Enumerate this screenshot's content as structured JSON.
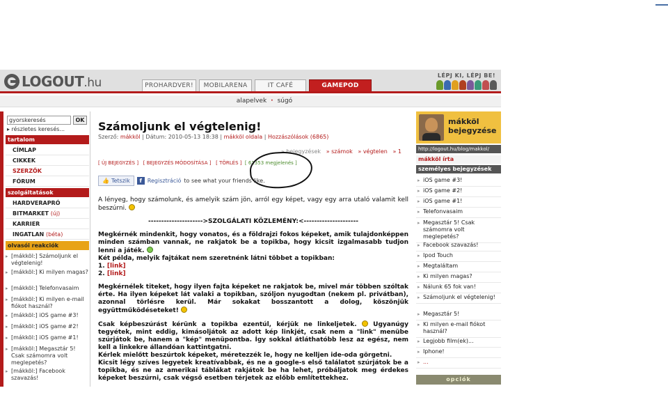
{
  "header": {
    "logo_main": "LOGOUT",
    "logo_suffix": ".hu",
    "slogan": "LÉPJ KI, LÉPJ BE!",
    "tabs": [
      "PROHARDVER!",
      "MOBILARENA",
      "IT CAFÉ",
      "GAMEPOD"
    ],
    "mascot_colors": [
      "#6a9a2a",
      "#3a6ab0",
      "#e0a020",
      "#b04020",
      "#7a5a9a",
      "#3a9a7a",
      "#c05050",
      "#5a5a5a"
    ]
  },
  "subnav": {
    "items": [
      "alapelvek",
      "súgó"
    ]
  },
  "sidebar": {
    "search_value": "gyorskeresés",
    "search_button": "OK",
    "advanced_search": "▸ részletes keresés...",
    "section_content": "tartalom",
    "content_items": [
      "CÍMLAP",
      "CIKKEK",
      "SZERZŐK",
      "FÓRUM"
    ],
    "section_services": "szolgáltatások",
    "services": [
      {
        "label": "HARDVERAPRÓ",
        "tag": ""
      },
      {
        "label": "BITMARKET",
        "tag": "(új)"
      },
      {
        "label": "KARRIER",
        "tag": ""
      },
      {
        "label": "INGATLAN",
        "tag": "(béta)"
      }
    ],
    "section_reactions": "olvasói reakciók",
    "reactions": [
      "[mákköl:] Számoljunk el végtelenig!",
      "[mákköl:] Ki milyen magas?",
      "[mákköl:] Telefonvasaim",
      "[mákköl:] Ki milyen e-mail fiókot használ?",
      "[mákköl:] iOS game #3!",
      "[mákköl:] iOS game #2!",
      "[mákköl:] iOS game #1!",
      "[mákköl:] Megasztár 5! Csak számomra volt meglepetés?",
      "[mákköl:] Facebook szavazás!"
    ]
  },
  "post": {
    "title": "Számoljunk el végtelenig!",
    "meta": {
      "author_label": "Szerző:",
      "author": "mákköl",
      "date_label": "Dátum:",
      "date": "2010-05-13 18:38",
      "page_link": "mákköl oldala",
      "comments": "Hozzászólások (6865)"
    },
    "crumbs": [
      "» bejegyzések",
      "» számok",
      "» végtelen",
      "» 1"
    ],
    "actions": [
      "[ ÚJ BEJEGYZÉS ]",
      "[ BEJEGYZÉS MÓDOSÍTÁSA ]",
      "[ TÖRLÉS ]"
    ],
    "views": "[ 61353 megjelenés ]",
    "fb_like": "Tetszik",
    "fb_register": "Regisztráció",
    "fb_suffix": "to see what your friends like.",
    "intro": "A lényeg, hogy számolunk, és amelyik szám jön, arról egy képet, vagy egy arra utaló valamit kell beszúrni.",
    "notice": "--------------------->SZOLGÁLATI KÖZLEMÉNY:<---------------------",
    "p1": "Megkérnék mindenkit, hogy vonatos, és a földrajzi fokos képeket, amik tulajdonképpen minden számban vannak, ne rakjatok be a topikba, hogy kicsit izgalmasabb tudjon lenni a játék.",
    "p2": "Két példa, melyik fajtákat nem szeretnénk látni többet a topikban:",
    "link1_num": "1.",
    "link2_num": "2.",
    "link_label": "[link]",
    "p3": "Megkérnélek titeket, hogy ilyen fajta képeket ne rakjatok be, mivel már többen szóltak érte. Ha ilyen képeket lát valaki a topikban, szóljon nyugodtan (nekem pl. privátban), azonnal törlésre kerül. Már sokakat bosszantott a dolog, köszönjük együttműködéseteket!",
    "p4a": "Csak képbeszúrást kérünk a topikba ezentúl, kérjük ne linkeljetek.",
    "p4b": "Ugyanúgy tegyétek, mint eddig, kimásoljátok az adott kép linkjét, csak nem a \"link\" menübe szúrjátok be, hanem a \"kép\" menüpontba. Így sokkal átláthatóbb lesz az egész, nem kell a linkekre állandóan kattintgatni.",
    "p5": "Kérlek mielőtt beszúrtok képeket, méretezzék le, hogy ne kelljen ide-oda görgetni.",
    "p6": "Kicsit légy szíves legyetek kreatívabbak, és ne a google-s első találatot szúrjátok be a topikba, és ne az amerikai táblákat rakjátok be ha lehet, próbáljatok meg érdekes képeket beszúrni, csak végső esetben térjetek az előbb említettekhez."
  },
  "right": {
    "title": "mákköl bejegyzése",
    "url": "http://logout.hu/blog/makkol/",
    "section_writes": "mákköl írta",
    "section_personal": "személyes bejegyzések",
    "items": [
      "iOS game #3!",
      "iOS game #2!",
      "iOS game #1!",
      "Telefonvasaim",
      "Megasztár 5! Csak számomra volt meglepetés?",
      "Facebook szavazás!",
      "Ipod Touch",
      "Megtaláltam",
      "Ki milyen magas?",
      "Nálunk 65 fok van!",
      "Számoljunk el végtelenig!",
      "Megasztár 5!",
      "Ki milyen e-mail fiókot használ?",
      "Legjobb film(ek)...",
      "Iphone!",
      "..."
    ],
    "options": "opciók"
  }
}
